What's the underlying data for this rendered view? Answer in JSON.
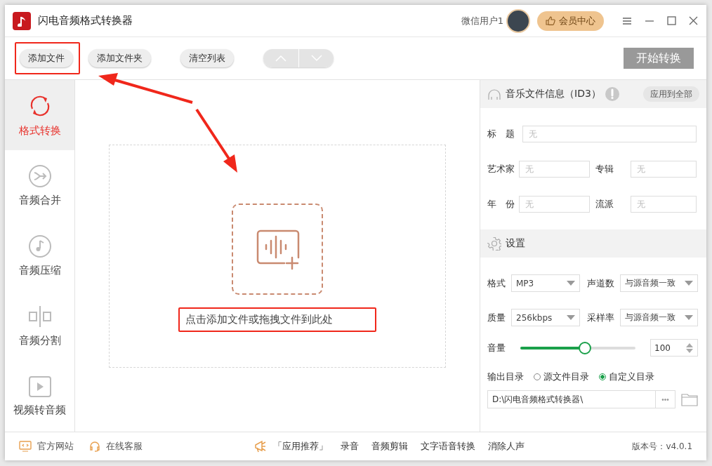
{
  "window": {
    "title": "闪电音频格式转换器",
    "user": "微信用户1",
    "vip_button": "会员中心"
  },
  "toolbar": {
    "buttons": [
      "添加文件",
      "添加文件夹",
      "清空列表"
    ],
    "start_button": "开始转换"
  },
  "sidebar": {
    "items": [
      {
        "label": "格式转换",
        "kind": "convert",
        "selected": true
      },
      {
        "label": "音频合并",
        "kind": "merge",
        "selected": false
      },
      {
        "label": "音频压缩",
        "kind": "compress",
        "selected": false
      },
      {
        "label": "音频分割",
        "kind": "split",
        "selected": false
      },
      {
        "label": "视频转音频",
        "kind": "video",
        "selected": false
      }
    ]
  },
  "drop_area": {
    "hint": "点击添加文件或拖拽文件到此处"
  },
  "id3": {
    "title": "音乐文件信息（ID3）",
    "apply_button": "应用到全部",
    "fields": [
      {
        "label": "标　题",
        "placeholder": "无",
        "wide": true
      },
      {
        "label": "艺术家",
        "placeholder": "无",
        "wide": false
      },
      {
        "label": "专辑",
        "placeholder": "无",
        "wide": false
      },
      {
        "label": "年　份",
        "placeholder": "无",
        "wide": false
      },
      {
        "label": "流派",
        "placeholder": "无",
        "wide": false
      }
    ]
  },
  "settings": {
    "title": "设置",
    "selects": [
      {
        "label": "格式",
        "value": "MP3"
      },
      {
        "label": "声道数",
        "value": "与源音频一致"
      },
      {
        "label": "质量",
        "value": "256kbps"
      },
      {
        "label": "采样率",
        "value": "与源音频一致"
      }
    ],
    "volume": {
      "label": "音量",
      "level": 0.5,
      "value": "100"
    },
    "output": {
      "label": "输出目录",
      "options": [
        {
          "label": "源文件目录",
          "selected": false
        },
        {
          "label": "自定义目录",
          "selected": true
        }
      ],
      "path": "D:\\闪电音频格式转换器\\",
      "browse_button": "•••"
    }
  },
  "footer": {
    "links": [
      {
        "label": "官方网站",
        "kind": "website"
      },
      {
        "label": "在线客服",
        "kind": "support"
      }
    ],
    "recommend_label": "「应用推荐」",
    "apps": [
      "录音",
      "音频剪辑",
      "文字语音转换",
      "消除人声"
    ],
    "version": "版本号：v4.0.1"
  }
}
